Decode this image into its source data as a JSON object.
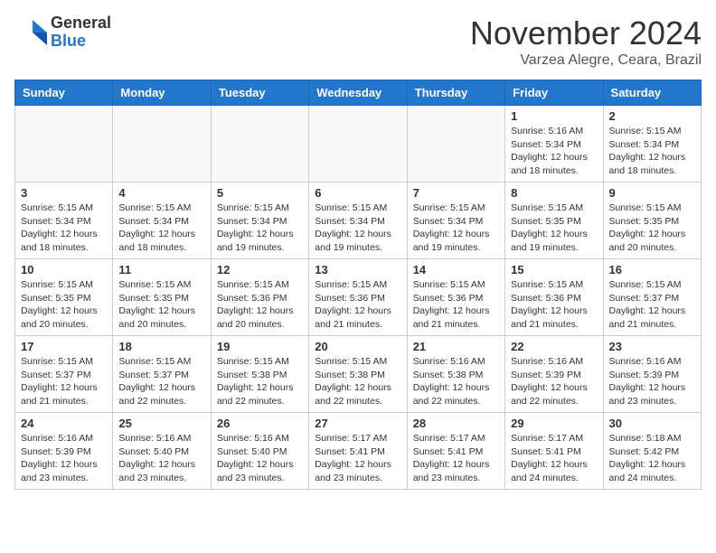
{
  "logo": {
    "general": "General",
    "blue": "Blue"
  },
  "title": "November 2024",
  "location": "Varzea Alegre, Ceara, Brazil",
  "days_of_week": [
    "Sunday",
    "Monday",
    "Tuesday",
    "Wednesday",
    "Thursday",
    "Friday",
    "Saturday"
  ],
  "weeks": [
    [
      {
        "day": "",
        "info": ""
      },
      {
        "day": "",
        "info": ""
      },
      {
        "day": "",
        "info": ""
      },
      {
        "day": "",
        "info": ""
      },
      {
        "day": "",
        "info": ""
      },
      {
        "day": "1",
        "info": "Sunrise: 5:16 AM\nSunset: 5:34 PM\nDaylight: 12 hours\nand 18 minutes."
      },
      {
        "day": "2",
        "info": "Sunrise: 5:15 AM\nSunset: 5:34 PM\nDaylight: 12 hours\nand 18 minutes."
      }
    ],
    [
      {
        "day": "3",
        "info": "Sunrise: 5:15 AM\nSunset: 5:34 PM\nDaylight: 12 hours\nand 18 minutes."
      },
      {
        "day": "4",
        "info": "Sunrise: 5:15 AM\nSunset: 5:34 PM\nDaylight: 12 hours\nand 18 minutes."
      },
      {
        "day": "5",
        "info": "Sunrise: 5:15 AM\nSunset: 5:34 PM\nDaylight: 12 hours\nand 19 minutes."
      },
      {
        "day": "6",
        "info": "Sunrise: 5:15 AM\nSunset: 5:34 PM\nDaylight: 12 hours\nand 19 minutes."
      },
      {
        "day": "7",
        "info": "Sunrise: 5:15 AM\nSunset: 5:34 PM\nDaylight: 12 hours\nand 19 minutes."
      },
      {
        "day": "8",
        "info": "Sunrise: 5:15 AM\nSunset: 5:35 PM\nDaylight: 12 hours\nand 19 minutes."
      },
      {
        "day": "9",
        "info": "Sunrise: 5:15 AM\nSunset: 5:35 PM\nDaylight: 12 hours\nand 20 minutes."
      }
    ],
    [
      {
        "day": "10",
        "info": "Sunrise: 5:15 AM\nSunset: 5:35 PM\nDaylight: 12 hours\nand 20 minutes."
      },
      {
        "day": "11",
        "info": "Sunrise: 5:15 AM\nSunset: 5:35 PM\nDaylight: 12 hours\nand 20 minutes."
      },
      {
        "day": "12",
        "info": "Sunrise: 5:15 AM\nSunset: 5:36 PM\nDaylight: 12 hours\nand 20 minutes."
      },
      {
        "day": "13",
        "info": "Sunrise: 5:15 AM\nSunset: 5:36 PM\nDaylight: 12 hours\nand 21 minutes."
      },
      {
        "day": "14",
        "info": "Sunrise: 5:15 AM\nSunset: 5:36 PM\nDaylight: 12 hours\nand 21 minutes."
      },
      {
        "day": "15",
        "info": "Sunrise: 5:15 AM\nSunset: 5:36 PM\nDaylight: 12 hours\nand 21 minutes."
      },
      {
        "day": "16",
        "info": "Sunrise: 5:15 AM\nSunset: 5:37 PM\nDaylight: 12 hours\nand 21 minutes."
      }
    ],
    [
      {
        "day": "17",
        "info": "Sunrise: 5:15 AM\nSunset: 5:37 PM\nDaylight: 12 hours\nand 21 minutes."
      },
      {
        "day": "18",
        "info": "Sunrise: 5:15 AM\nSunset: 5:37 PM\nDaylight: 12 hours\nand 22 minutes."
      },
      {
        "day": "19",
        "info": "Sunrise: 5:15 AM\nSunset: 5:38 PM\nDaylight: 12 hours\nand 22 minutes."
      },
      {
        "day": "20",
        "info": "Sunrise: 5:15 AM\nSunset: 5:38 PM\nDaylight: 12 hours\nand 22 minutes."
      },
      {
        "day": "21",
        "info": "Sunrise: 5:16 AM\nSunset: 5:38 PM\nDaylight: 12 hours\nand 22 minutes."
      },
      {
        "day": "22",
        "info": "Sunrise: 5:16 AM\nSunset: 5:39 PM\nDaylight: 12 hours\nand 22 minutes."
      },
      {
        "day": "23",
        "info": "Sunrise: 5:16 AM\nSunset: 5:39 PM\nDaylight: 12 hours\nand 23 minutes."
      }
    ],
    [
      {
        "day": "24",
        "info": "Sunrise: 5:16 AM\nSunset: 5:39 PM\nDaylight: 12 hours\nand 23 minutes."
      },
      {
        "day": "25",
        "info": "Sunrise: 5:16 AM\nSunset: 5:40 PM\nDaylight: 12 hours\nand 23 minutes."
      },
      {
        "day": "26",
        "info": "Sunrise: 5:16 AM\nSunset: 5:40 PM\nDaylight: 12 hours\nand 23 minutes."
      },
      {
        "day": "27",
        "info": "Sunrise: 5:17 AM\nSunset: 5:41 PM\nDaylight: 12 hours\nand 23 minutes."
      },
      {
        "day": "28",
        "info": "Sunrise: 5:17 AM\nSunset: 5:41 PM\nDaylight: 12 hours\nand 23 minutes."
      },
      {
        "day": "29",
        "info": "Sunrise: 5:17 AM\nSunset: 5:41 PM\nDaylight: 12 hours\nand 24 minutes."
      },
      {
        "day": "30",
        "info": "Sunrise: 5:18 AM\nSunset: 5:42 PM\nDaylight: 12 hours\nand 24 minutes."
      }
    ]
  ]
}
